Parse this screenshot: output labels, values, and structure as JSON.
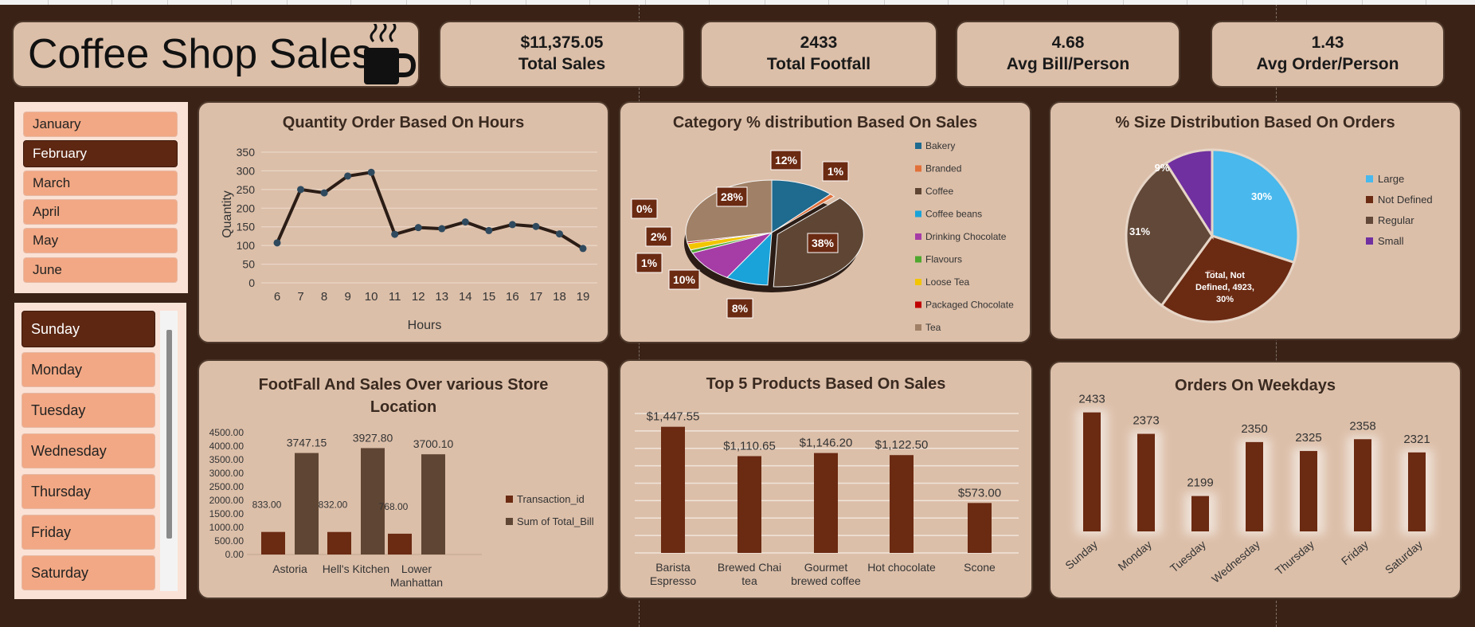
{
  "header": {
    "title": "Coffee Shop Sales",
    "icon": "coffee-cup-icon"
  },
  "kpis": [
    {
      "value": "$11,375.05",
      "label": "Total Sales"
    },
    {
      "value": "2433",
      "label": "Total Footfall"
    },
    {
      "value": "4.68",
      "label": "Avg Bill/Person"
    },
    {
      "value": "1.43",
      "label": "Avg Order/Person"
    }
  ],
  "month_slicer": {
    "items": [
      "January",
      "February",
      "March",
      "April",
      "May",
      "June"
    ],
    "selected": "February"
  },
  "day_slicer": {
    "items": [
      "Sunday",
      "Monday",
      "Tuesday",
      "Wednesday",
      "Thursday",
      "Friday",
      "Saturday"
    ],
    "selected": "Sunday"
  },
  "colors": {
    "dark_brown": "#6b2a12",
    "mid_brown": "#5f4634",
    "card_bg": "#dcbfa9",
    "background": "#3a2216",
    "slicer_item": "#f2a884",
    "slicer_selected": "#5d2712"
  },
  "charts": {
    "hours": {
      "title": "Quantity Order Based On Hours",
      "xlabel": "Hours",
      "ylabel": "Quantity"
    },
    "category": {
      "title": "Category % distribution Based On Sales"
    },
    "size": {
      "title": "% Size Distribution Based On Orders",
      "tooltip_lines": [
        "Total, Not",
        "Defined, 4923,",
        "30%"
      ]
    },
    "store": {
      "title_line1": "FootFall And Sales Over various Store",
      "title_line2": "Location"
    },
    "products": {
      "title": "Top 5  Products Based On Sales"
    },
    "weekdays": {
      "title": "Orders  On Weekdays"
    }
  },
  "chart_data": [
    {
      "type": "line",
      "title": "Quantity Order Based On Hours",
      "xlabel": "Hours",
      "ylabel": "Quantity",
      "x": [
        6,
        7,
        8,
        9,
        10,
        11,
        12,
        13,
        14,
        15,
        16,
        17,
        18,
        19
      ],
      "values": [
        107,
        250,
        241,
        286,
        296,
        130,
        148,
        145,
        163,
        140,
        156,
        151,
        131,
        92
      ],
      "ylim": [
        0,
        350
      ],
      "yticks": [
        0,
        50,
        100,
        150,
        200,
        250,
        300,
        350
      ],
      "grid": true
    },
    {
      "type": "pie",
      "title": "Category % distribution Based On Sales",
      "legend_position": "right",
      "slices": [
        {
          "name": "Bakery",
          "label": "12%",
          "value": 12,
          "color": "#1f6a8f"
        },
        {
          "name": "Branded",
          "label": "1%",
          "value": 1,
          "color": "#e2703a"
        },
        {
          "name": "Coffee",
          "label": "38%",
          "value": 38,
          "color": "#5f4634"
        },
        {
          "name": "Coffee beans",
          "label": "8%",
          "value": 8,
          "color": "#1aa3d9"
        },
        {
          "name": "Drinking Chocolate",
          "label": "10%",
          "value": 10,
          "color": "#a63ca6"
        },
        {
          "name": "Flavours",
          "label": "1%",
          "value": 1,
          "color": "#4ea72e"
        },
        {
          "name": "Loose Tea",
          "label": "2%",
          "value": 2,
          "color": "#f2c500"
        },
        {
          "name": "Packaged Chocolate",
          "label": "0%",
          "value": 0.5,
          "color": "#c00000"
        },
        {
          "name": "Tea",
          "label": "28%",
          "value": 28,
          "color": "#a08066"
        }
      ]
    },
    {
      "type": "pie",
      "title": "% Size Distribution Based On Orders",
      "legend_position": "right",
      "slices": [
        {
          "name": "Large",
          "label": "30%",
          "value": 30,
          "color": "#49b8ec"
        },
        {
          "name": "Not Defined",
          "label": "30%",
          "value": 30,
          "color": "#6b2a12"
        },
        {
          "name": "Regular",
          "label": "31%",
          "value": 31,
          "color": "#624838"
        },
        {
          "name": "Small",
          "label": "9%",
          "value": 9,
          "color": "#7030a0"
        }
      ]
    },
    {
      "type": "bar",
      "title": "FootFall And Sales Over various Store Location",
      "categories": [
        "Astoria",
        "Hell's Kitchen",
        "Lower Manhattan"
      ],
      "series": [
        {
          "name": "Transaction_id",
          "values": [
            833.0,
            832.0,
            768.0
          ],
          "labels": [
            "833.00",
            "832.00",
            "768.00"
          ],
          "color": "#6b2a12"
        },
        {
          "name": "Sum of Total_Bill",
          "values": [
            3747.15,
            3927.8,
            3700.1
          ],
          "labels": [
            "3747.15",
            "3927.80",
            "3700.10"
          ],
          "color": "#5f4634"
        }
      ],
      "ylim": [
        0,
        4500
      ],
      "yticks": [
        "0.00",
        "500.00",
        "1000.00",
        "1500.00",
        "2000.00",
        "2500.00",
        "3000.00",
        "3500.00",
        "4000.00",
        "4500.00"
      ],
      "legend_position": "right"
    },
    {
      "type": "bar",
      "title": "Top 5  Products Based On Sales",
      "categories": [
        "Barista Espresso",
        "Brewed Chai tea",
        "Gourmet brewed coffee",
        "Hot chocolate",
        "Scone"
      ],
      "values": [
        1447.55,
        1110.65,
        1146.2,
        1122.5,
        573.0
      ],
      "labels": [
        "$1,447.55",
        "$1,110.65",
        "$1,146.20",
        "$1,122.50",
        "$573.00"
      ],
      "ylim": [
        0,
        1600
      ],
      "grid": true
    },
    {
      "type": "bar",
      "title": "Orders  On Weekdays",
      "categories": [
        "Sunday",
        "Monday",
        "Tuesday",
        "Wednesday",
        "Thursday",
        "Friday",
        "Saturday"
      ],
      "values": [
        2433,
        2373,
        2199,
        2350,
        2325,
        2358,
        2321
      ],
      "ylim": [
        2100,
        2450
      ]
    }
  ]
}
